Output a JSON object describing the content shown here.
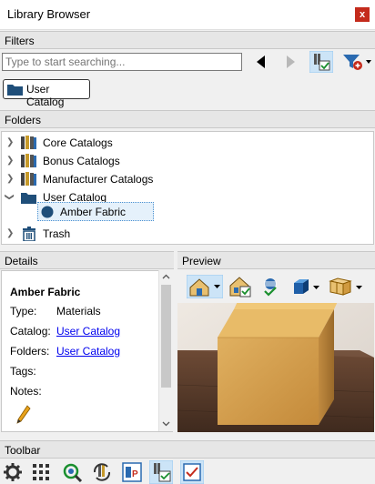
{
  "window": {
    "title": "Library Browser",
    "close_label": "x"
  },
  "filters": {
    "header": "Filters",
    "search_placeholder": "Type to start searching...",
    "active_chip": "User Catalog"
  },
  "folders": {
    "header": "Folders",
    "items": [
      {
        "label": "Core Catalogs"
      },
      {
        "label": "Bonus Catalogs"
      },
      {
        "label": "Manufacturer Catalogs"
      },
      {
        "label": "User Catalog"
      },
      {
        "label": "Amber Fabric"
      },
      {
        "label": "Trash"
      }
    ]
  },
  "details": {
    "header": "Details",
    "name": "Amber Fabric",
    "type_label": "Type:",
    "type_value": "Materials",
    "catalog_label": "Catalog:",
    "catalog_value": "User Catalog",
    "folders_label": "Folders:",
    "folders_value": "User Catalog",
    "tags_label": "Tags:",
    "notes_label": "Notes:"
  },
  "preview": {
    "header": "Preview"
  },
  "toolbar": {
    "header": "Toolbar"
  },
  "colors": {
    "accent": "#0078d7",
    "folder": "#1f4e79",
    "close": "#c42b1c",
    "wood": "#d4a35a"
  }
}
